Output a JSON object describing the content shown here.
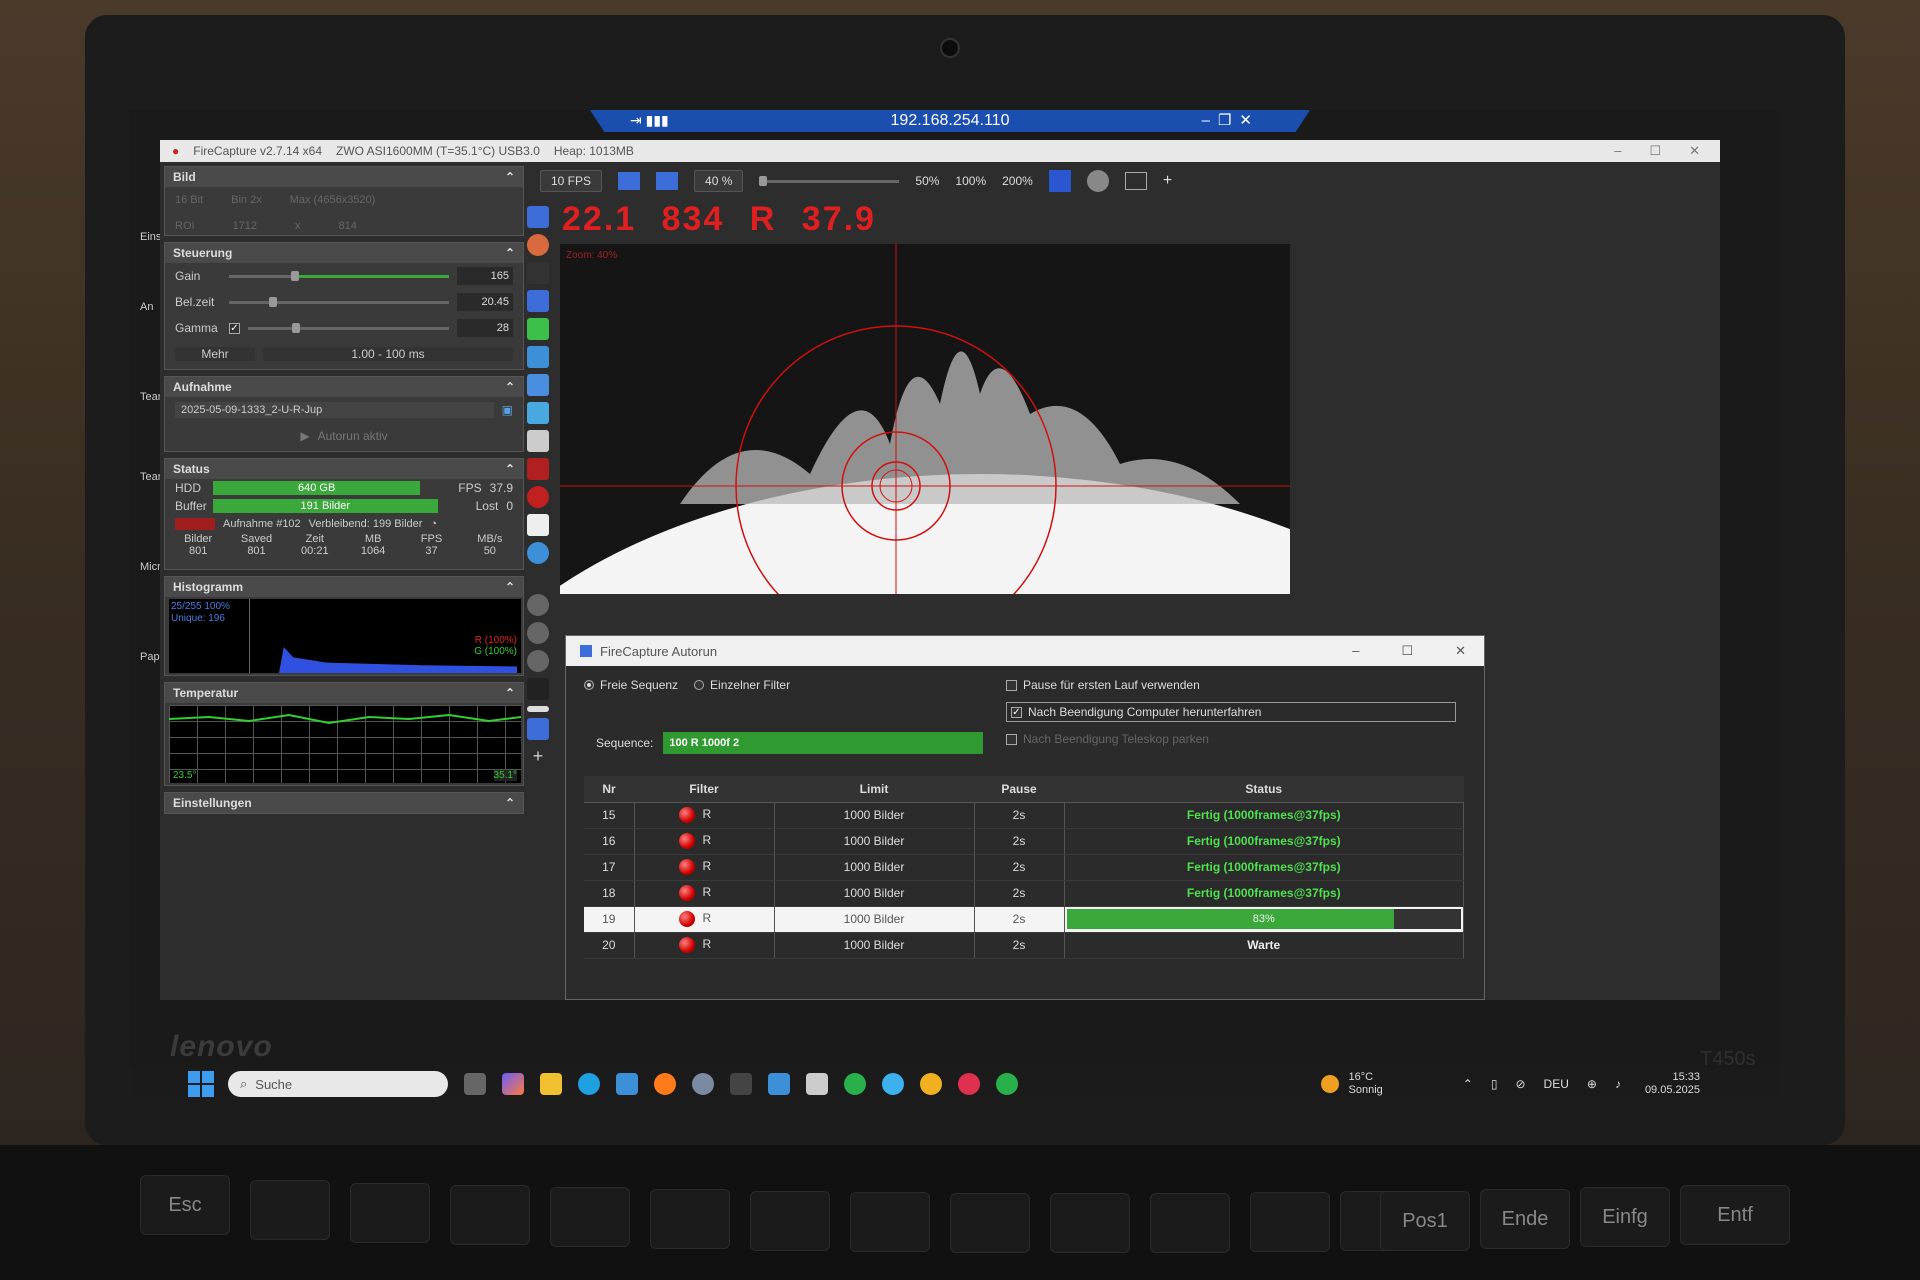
{
  "remote": {
    "address": "192.168.254.110"
  },
  "app": {
    "title": "FireCapture v2.7.14 x64",
    "camera": "ZWO ASI1600MM (T=35.1°C) USB3.0",
    "heap": "Heap: 1013MB"
  },
  "bild": {
    "header": "Bild",
    "bits": "16 Bit",
    "binning": "Bin 2x",
    "max": "Max (4656x3520)",
    "roi_label": "ROI",
    "roi_w": "1712",
    "roi_x": "x",
    "roi_h": "814"
  },
  "steuerung": {
    "header": "Steuerung",
    "gain_label": "Gain",
    "gain_value": "165",
    "exposure_label": "Bel.zeit",
    "exposure_value": "20.45",
    "gamma_label": "Gamma",
    "gamma_value": "28",
    "more_label": "Mehr",
    "range": "1.00 - 100 ms"
  },
  "aufnahme": {
    "header": "Aufnahme",
    "filename": "2025-05-09-1333_2-U-R-Jup",
    "autorun": "Autorun aktiv"
  },
  "status": {
    "header": "Status",
    "hdd_label": "HDD",
    "hdd_value": "640 GB",
    "fps_label": "FPS",
    "fps_value": "37.9",
    "buffer_label": "Buffer",
    "buffer_value": "191 Bilder",
    "lost_label": "Lost",
    "lost_value": "0",
    "recording": "Aufnahme #102",
    "remaining": "Verbleibend:  199 Bilder",
    "cols": [
      "Bilder",
      "Saved",
      "Zeit",
      "MB",
      "FPS",
      "MB/s"
    ],
    "vals": [
      "801",
      "801",
      "00:21",
      "1064",
      "37",
      "50"
    ]
  },
  "histogram": {
    "header": "Histogramm",
    "range": "25/255 100%",
    "unique": "Unique: 196",
    "r": "R (100%)",
    "g": "G (100%)"
  },
  "temperatur": {
    "header": "Temperatur",
    "min": "23.5°",
    "max": "35.1°"
  },
  "einstellungen": {
    "header": "Einstellungen"
  },
  "toolbar": {
    "fps": "10 FPS",
    "zoom_current": "40 %",
    "zoom_50": "50%",
    "zoom_100": "100%",
    "zoom_200": "200%",
    "plus": "+"
  },
  "readout": "22.1  834  R  37.9",
  "view": {
    "zoom_label": "Zoom: 40%"
  },
  "autorun": {
    "title": "FireCapture Autorun",
    "free_sequence": "Freie Sequenz",
    "single_filter": "Einzelner Filter",
    "pause_first": "Pause für ersten Lauf verwenden",
    "shutdown": "Nach Beendigung Computer herunterfahren",
    "park": "Nach Beendigung Teleskop parken",
    "sequence_label": "Sequence:",
    "sequence_value": "100 R 1000f 2",
    "columns": [
      "Nr",
      "Filter",
      "Limit",
      "Pause",
      "Status"
    ],
    "rows": [
      {
        "nr": "15",
        "filter": "R",
        "limit": "1000 Bilder",
        "pause": "2s",
        "status": "Fertig  (1000frames@37fps)",
        "state": "done"
      },
      {
        "nr": "16",
        "filter": "R",
        "limit": "1000 Bilder",
        "pause": "2s",
        "status": "Fertig  (1000frames@37fps)",
        "state": "done"
      },
      {
        "nr": "17",
        "filter": "R",
        "limit": "1000 Bilder",
        "pause": "2s",
        "status": "Fertig  (1000frames@37fps)",
        "state": "done"
      },
      {
        "nr": "18",
        "filter": "R",
        "limit": "1000 Bilder",
        "pause": "2s",
        "status": "Fertig  (1000frames@37fps)",
        "state": "done"
      },
      {
        "nr": "19",
        "filter": "R",
        "limit": "1000 Bilder",
        "pause": "2s",
        "status": "83%",
        "state": "running",
        "progress": 0.83
      },
      {
        "nr": "20",
        "filter": "R",
        "limit": "1000 Bilder",
        "pause": "2s",
        "status": "Warte",
        "state": "waiting"
      }
    ]
  },
  "taskbar": {
    "search": "Suche",
    "temp": "16°C",
    "weather": "Sonnig",
    "lang": "DEU",
    "time": "15:33",
    "date": "09.05.2025"
  },
  "laptop": {
    "brand": "lenovo",
    "model": "T450s"
  },
  "keys": [
    "Esc",
    "Pos1",
    "Ende",
    "Einfg",
    "Entf"
  ],
  "desktop": [
    "Einst",
    "An",
    "TeamV",
    "Tean",
    "Micro",
    "Pap"
  ]
}
